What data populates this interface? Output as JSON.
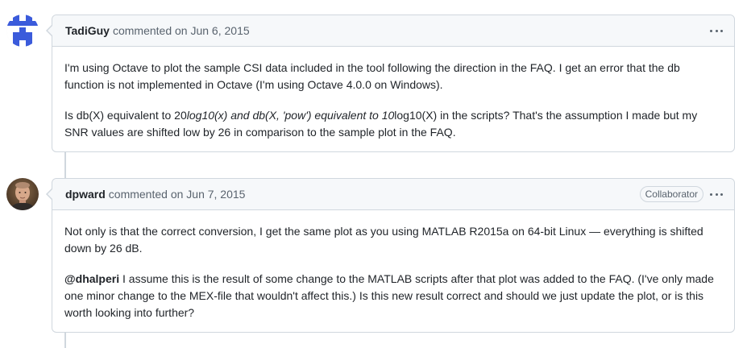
{
  "comments": [
    {
      "author": "TadiGuy",
      "meta": "commented on Jun 6, 2015",
      "avatar_icon": "identicon-avatar",
      "p1": "I'm using Octave to plot the sample CSI data included in the tool following the direction in the FAQ. I get an error that the db function is not implemented in Octave (I'm using Octave 4.0.0 on Windows).",
      "p2_a": "Is db(X) equivalent to 20",
      "p2_b": "log10(x) and db(X, 'pow') equivalent to 10",
      "p2_c": "log10(X) in the scripts? That's the assumption I made but my SNR values are shifted low by 26 in comparison to the sample plot in the FAQ."
    },
    {
      "author": "dpward",
      "meta": "commented on Jun 7, 2015",
      "badge": "Collaborator",
      "avatar_icon": "photo-avatar",
      "p1": "Not only is that the correct conversion, I get the same plot as you using MATLAB R2015a on 64-bit Linux — everything is shifted down by 26 dB.",
      "mention": "@dhalperi",
      "p2": " I assume this is the result of some change to the MATLAB scripts after that plot was added to the FAQ. (I've only made one minor change to the MEX-file that wouldn't affect this.) Is this new result correct and should we just update the plot, or is this worth looking into further?"
    }
  ],
  "colors": {
    "border": "#d0d7de",
    "header_bg": "#f6f8fa",
    "muted": "#59636e",
    "identicon": "#3b5bdb"
  }
}
